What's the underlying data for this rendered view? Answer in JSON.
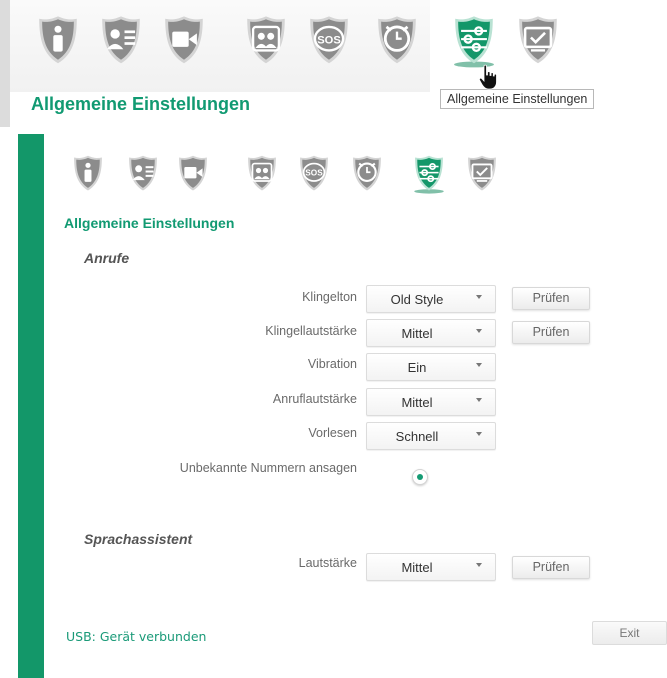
{
  "zoom_header": {
    "title": "Allgemeine Einstellungen",
    "tooltip": "Allgemeine Einstellungen",
    "icons": [
      {
        "name": "info-icon",
        "active": false
      },
      {
        "name": "contact-card-icon",
        "active": false
      },
      {
        "name": "video-icon",
        "active": false
      },
      {
        "name": "contacts-icon",
        "active": false
      },
      {
        "name": "sos-icon",
        "active": false
      },
      {
        "name": "alarm-clock-icon",
        "active": false
      },
      {
        "name": "settings-sliders-icon",
        "active": true
      },
      {
        "name": "display-icon",
        "active": false
      }
    ]
  },
  "nav": {
    "icons": [
      {
        "name": "info-icon",
        "active": false
      },
      {
        "name": "contact-card-icon",
        "active": false
      },
      {
        "name": "video-icon",
        "active": false
      },
      {
        "name": "contacts-icon",
        "active": false
      },
      {
        "name": "sos-icon",
        "active": false
      },
      {
        "name": "alarm-clock-icon",
        "active": false
      },
      {
        "name": "settings-sliders-icon",
        "active": true
      },
      {
        "name": "display-icon",
        "active": false
      }
    ],
    "sos_text": "SOS"
  },
  "page": {
    "title": "Allgemeine Einstellungen"
  },
  "calls": {
    "heading": "Anrufe",
    "ringtone": {
      "label": "Klingelton",
      "value": "Old Style",
      "button": "Prüfen"
    },
    "ring_volume": {
      "label": "Klingellautstärke",
      "value": "Mittel",
      "button": "Prüfen"
    },
    "vibration": {
      "label": "Vibration",
      "value": "Ein"
    },
    "call_volume": {
      "label": "Anruflautstärke",
      "value": "Mittel"
    },
    "read_aloud": {
      "label": "Vorlesen",
      "value": "Schnell"
    },
    "unknown_numbers": {
      "label": "Unbekannte Nummern ansagen",
      "checked": true
    }
  },
  "assistant": {
    "heading": "Sprachassistent",
    "volume": {
      "label": "Lautstärke",
      "value": "Mittel",
      "button": "Prüfen"
    }
  },
  "footer": {
    "status": "USB: Gerät verbunden",
    "exit_label": "Exit"
  },
  "colors": {
    "accent": "#139769",
    "icon_gray": "#8c8c8c",
    "title_green": "#119a72"
  }
}
